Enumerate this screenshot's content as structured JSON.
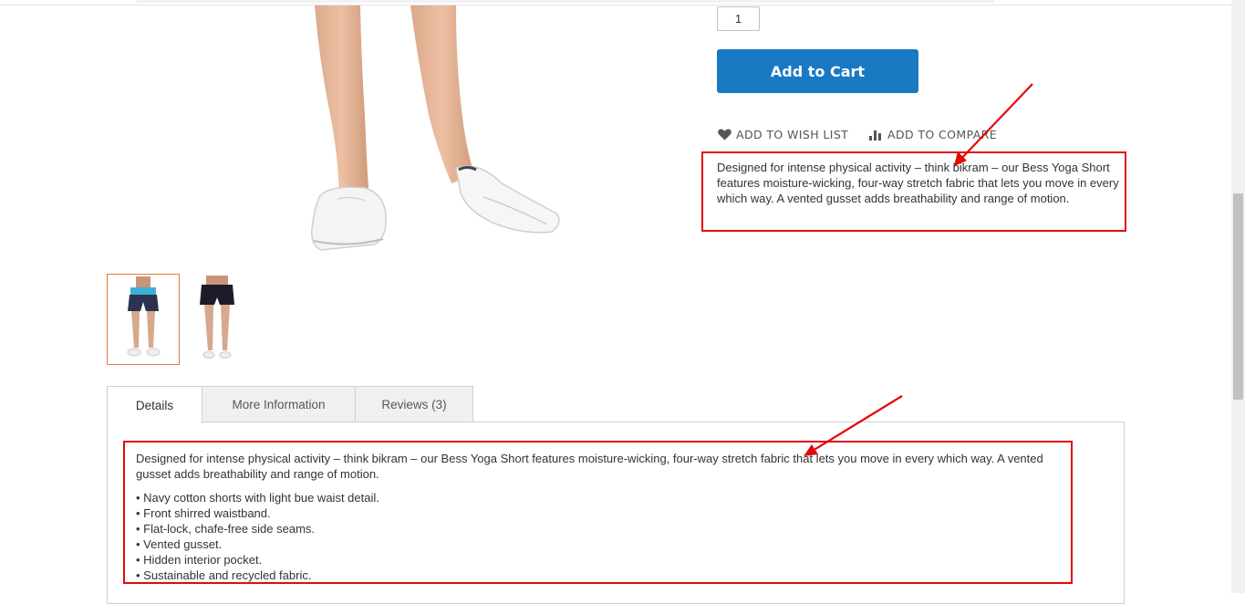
{
  "product": {
    "qty_value": "1",
    "add_to_cart_label": "Add to Cart",
    "wishlist_label": "ADD TO WISH LIST",
    "compare_label": "ADD TO COMPARE",
    "overview": "Designed for intense physical activity – think bikram – our Bess Yoga Short features moisture-wicking, four-way stretch fabric that lets you move in every which way. A vented gusset adds breathability and range of motion."
  },
  "gallery": {
    "thumbnails": [
      {
        "name": "thumbnail-front",
        "active": true
      },
      {
        "name": "thumbnail-back",
        "active": false
      }
    ]
  },
  "tabs": [
    {
      "label": "Details",
      "active": true
    },
    {
      "label": "More Information",
      "active": false
    },
    {
      "label": "Reviews (3)",
      "active": false
    }
  ],
  "details": {
    "description": "Designed for intense physical activity – think bikram – our Bess Yoga Short features moisture-wicking, four-way stretch fabric that lets you move in every which way. A vented gusset adds breathability and range of motion.",
    "features": [
      "Navy cotton shorts with light bue waist detail.",
      "Front shirred waistband.",
      "Flat-lock, chafe-free side seams.",
      "Vented gusset.",
      "Hidden interior pocket.",
      "Sustainable and recycled fabric."
    ]
  },
  "colors": {
    "primary": "#1979c3",
    "annotation_red": "#e20a0a",
    "thumb_active_border": "#e07b39"
  }
}
